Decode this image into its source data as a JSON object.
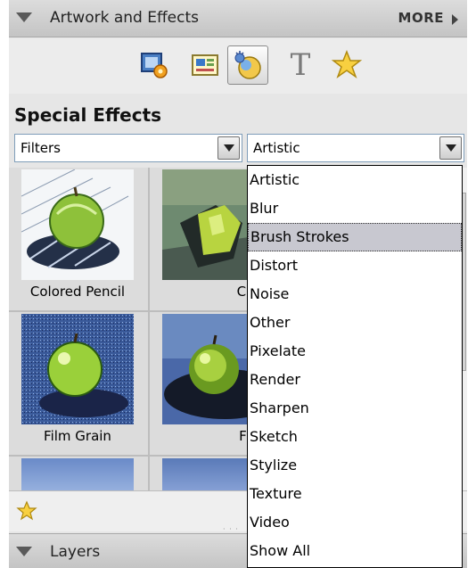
{
  "panel": {
    "title": "Artwork and Effects",
    "more_label": "MORE",
    "toolbar": [
      {
        "name": "photo-frame-icon"
      },
      {
        "name": "backgrounds-icon"
      },
      {
        "name": "effects-icon",
        "selected": true
      },
      {
        "name": "text-icon",
        "glyph": "T"
      },
      {
        "name": "favorites-star-icon"
      }
    ],
    "section_title": "Special Effects",
    "category_select": {
      "value": "Filters"
    },
    "filter_select": {
      "value": "Artistic"
    },
    "thumbnails": [
      {
        "label": "Colored Pencil"
      },
      {
        "label": "Cutout"
      },
      {
        "label": "Film Grain"
      },
      {
        "label": "Fresco"
      }
    ],
    "dropdown_options": [
      "Artistic",
      "Blur",
      "Brush Strokes",
      "Distort",
      "Noise",
      "Other",
      "Pixelate",
      "Render",
      "Sharpen",
      "Sketch",
      "Stylize",
      "Texture",
      "Video",
      "Show All"
    ],
    "highlighted_option": "Brush Strokes",
    "layers_title": "Layers"
  },
  "colors": {
    "header_bg": "#cfcfcf",
    "panel_bg": "#e6e6e6",
    "highlight": "#c8c8d0",
    "select_border": "#7f9db9"
  }
}
